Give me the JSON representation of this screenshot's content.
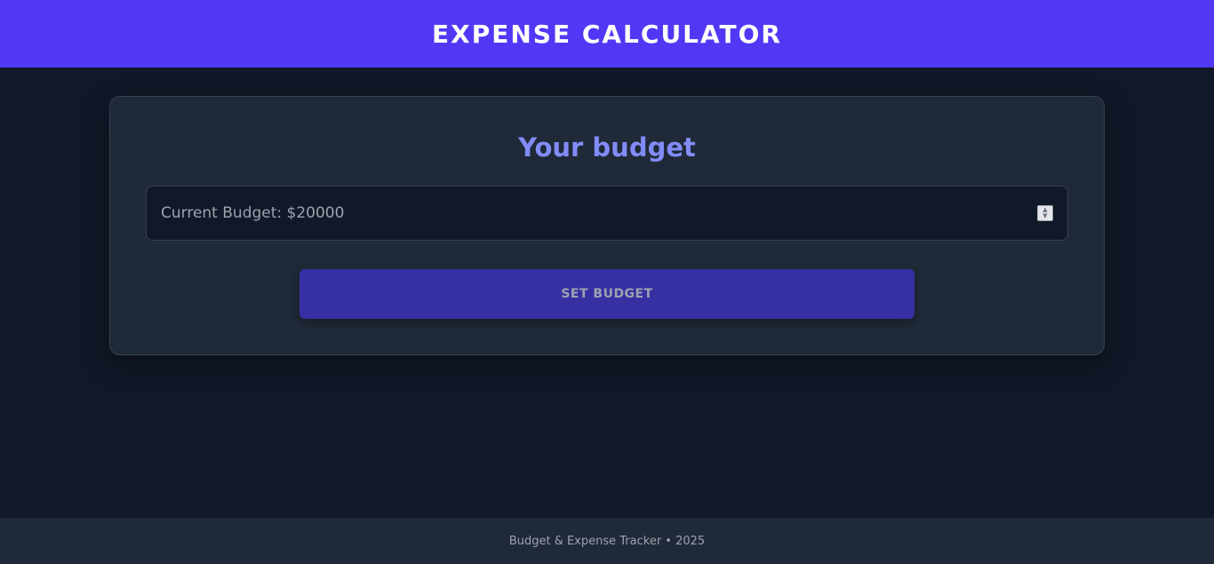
{
  "header": {
    "title": "EXPENSE CALCULATOR"
  },
  "budget_card": {
    "title": "Your budget",
    "input_placeholder": "Current Budget: $20000",
    "input_value": "",
    "button_label": "SET BUDGET"
  },
  "footer": {
    "text": "Budget & Expense Tracker • 2025"
  },
  "colors": {
    "header_bg": "#5138f5",
    "page_bg": "#111827",
    "card_bg": "#1f2937",
    "accent_text": "#818cf8",
    "button_bg": "#3730a3"
  },
  "icons": {
    "spinner": "number-spinner-icon"
  }
}
